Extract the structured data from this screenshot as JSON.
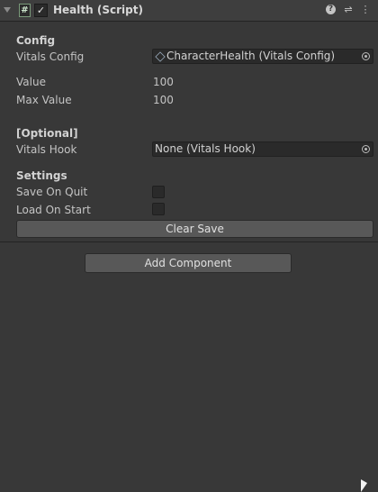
{
  "header": {
    "title": "Health (Script)",
    "script_glyph": "#",
    "enabled_check": "✓",
    "icons": [
      "foldout-arrow-icon",
      "script-icon",
      "help-icon",
      "preset-icon",
      "context-menu-icon"
    ]
  },
  "config": {
    "section": "Config",
    "vitals_config_label": "Vitals Config",
    "vitals_config_value": "CharacterHealth (Vitals Config)",
    "value_label": "Value",
    "value": "100",
    "max_value_label": "Max Value",
    "max_value": "100"
  },
  "optional": {
    "section": "[Optional]",
    "vitals_hook_label": "Vitals Hook",
    "vitals_hook_value": "None (Vitals Hook)"
  },
  "settings": {
    "section": "Settings",
    "save_on_quit_label": "Save On Quit",
    "save_on_quit": false,
    "load_on_start_label": "Load On Start",
    "load_on_start": false,
    "clear_save_label": "Clear Save"
  },
  "add_component_label": "Add Component"
}
